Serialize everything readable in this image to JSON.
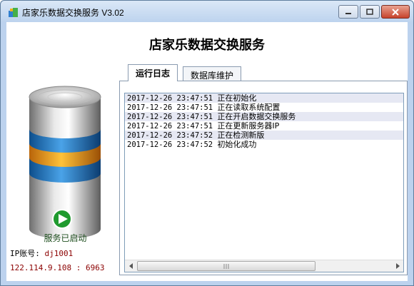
{
  "window": {
    "title": "店家乐数据交换服务 V3.02",
    "app_title": "店家乐数据交换服务"
  },
  "service": {
    "status": "服务已启动",
    "ip_label": "IP账号:",
    "ip_account": "dj1001",
    "address": "122.114.9.108 : 6963"
  },
  "tabs": [
    {
      "label": "运行日志",
      "active": true
    },
    {
      "label": "数据库维护",
      "active": false
    }
  ],
  "log": [
    {
      "time": "2017-12-26  23:47:51",
      "message": "正在初始化"
    },
    {
      "time": "2017-12-26  23:47:51",
      "message": "正在读取系统配置"
    },
    {
      "time": "2017-12-26  23:47:51",
      "message": "正在开启数据交换服务"
    },
    {
      "time": "2017-12-26  23:47:51",
      "message": "正在更新服务器IP"
    },
    {
      "time": "2017-12-26  23:47:52",
      "message": "正在检测新版"
    },
    {
      "time": "2017-12-26  23:47:52",
      "message": "初始化成功"
    }
  ],
  "colors": {
    "accent_red": "#8b0000",
    "play_green": "#1f9a2e"
  }
}
